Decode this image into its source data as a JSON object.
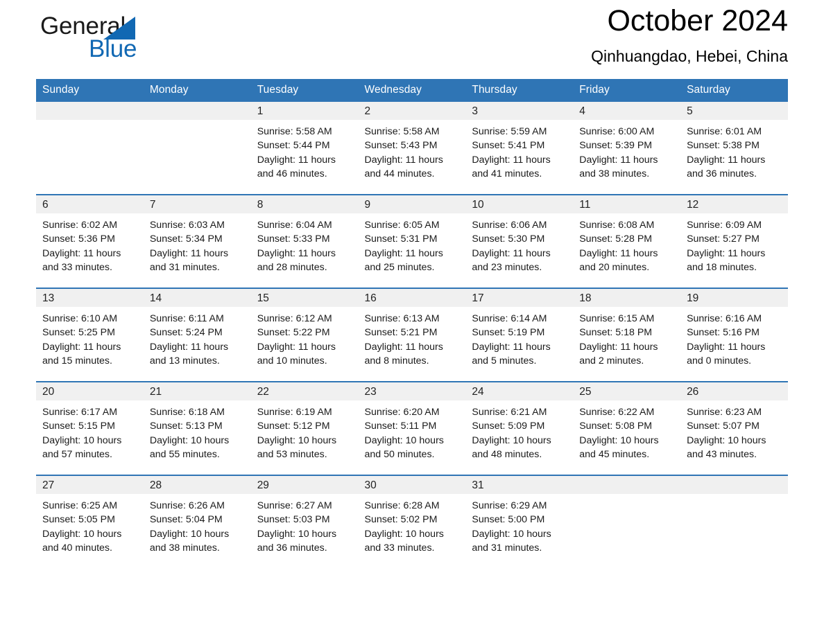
{
  "brand": {
    "name_part1": "General",
    "name_part2": "Blue",
    "triangle_color": "#1168b3"
  },
  "header": {
    "month_title": "October 2024",
    "location": "Qinhuangdao, Hebei, China"
  },
  "theme": {
    "header_blue": "#2f75b5",
    "daynum_band": "#f0f0f0",
    "text": "#1a1a1a"
  },
  "weekday_headers": [
    "Sunday",
    "Monday",
    "Tuesday",
    "Wednesday",
    "Thursday",
    "Friday",
    "Saturday"
  ],
  "weeks": [
    [
      {
        "day": "",
        "sunrise": "",
        "sunset": "",
        "daylight_l1": "",
        "daylight_l2": "",
        "empty": true
      },
      {
        "day": "",
        "sunrise": "",
        "sunset": "",
        "daylight_l1": "",
        "daylight_l2": "",
        "empty": true
      },
      {
        "day": "1",
        "sunrise": "Sunrise: 5:58 AM",
        "sunset": "Sunset: 5:44 PM",
        "daylight_l1": "Daylight: 11 hours",
        "daylight_l2": "and 46 minutes."
      },
      {
        "day": "2",
        "sunrise": "Sunrise: 5:58 AM",
        "sunset": "Sunset: 5:43 PM",
        "daylight_l1": "Daylight: 11 hours",
        "daylight_l2": "and 44 minutes."
      },
      {
        "day": "3",
        "sunrise": "Sunrise: 5:59 AM",
        "sunset": "Sunset: 5:41 PM",
        "daylight_l1": "Daylight: 11 hours",
        "daylight_l2": "and 41 minutes."
      },
      {
        "day": "4",
        "sunrise": "Sunrise: 6:00 AM",
        "sunset": "Sunset: 5:39 PM",
        "daylight_l1": "Daylight: 11 hours",
        "daylight_l2": "and 38 minutes."
      },
      {
        "day": "5",
        "sunrise": "Sunrise: 6:01 AM",
        "sunset": "Sunset: 5:38 PM",
        "daylight_l1": "Daylight: 11 hours",
        "daylight_l2": "and 36 minutes."
      }
    ],
    [
      {
        "day": "6",
        "sunrise": "Sunrise: 6:02 AM",
        "sunset": "Sunset: 5:36 PM",
        "daylight_l1": "Daylight: 11 hours",
        "daylight_l2": "and 33 minutes."
      },
      {
        "day": "7",
        "sunrise": "Sunrise: 6:03 AM",
        "sunset": "Sunset: 5:34 PM",
        "daylight_l1": "Daylight: 11 hours",
        "daylight_l2": "and 31 minutes."
      },
      {
        "day": "8",
        "sunrise": "Sunrise: 6:04 AM",
        "sunset": "Sunset: 5:33 PM",
        "daylight_l1": "Daylight: 11 hours",
        "daylight_l2": "and 28 minutes."
      },
      {
        "day": "9",
        "sunrise": "Sunrise: 6:05 AM",
        "sunset": "Sunset: 5:31 PM",
        "daylight_l1": "Daylight: 11 hours",
        "daylight_l2": "and 25 minutes."
      },
      {
        "day": "10",
        "sunrise": "Sunrise: 6:06 AM",
        "sunset": "Sunset: 5:30 PM",
        "daylight_l1": "Daylight: 11 hours",
        "daylight_l2": "and 23 minutes."
      },
      {
        "day": "11",
        "sunrise": "Sunrise: 6:08 AM",
        "sunset": "Sunset: 5:28 PM",
        "daylight_l1": "Daylight: 11 hours",
        "daylight_l2": "and 20 minutes."
      },
      {
        "day": "12",
        "sunrise": "Sunrise: 6:09 AM",
        "sunset": "Sunset: 5:27 PM",
        "daylight_l1": "Daylight: 11 hours",
        "daylight_l2": "and 18 minutes."
      }
    ],
    [
      {
        "day": "13",
        "sunrise": "Sunrise: 6:10 AM",
        "sunset": "Sunset: 5:25 PM",
        "daylight_l1": "Daylight: 11 hours",
        "daylight_l2": "and 15 minutes."
      },
      {
        "day": "14",
        "sunrise": "Sunrise: 6:11 AM",
        "sunset": "Sunset: 5:24 PM",
        "daylight_l1": "Daylight: 11 hours",
        "daylight_l2": "and 13 minutes."
      },
      {
        "day": "15",
        "sunrise": "Sunrise: 6:12 AM",
        "sunset": "Sunset: 5:22 PM",
        "daylight_l1": "Daylight: 11 hours",
        "daylight_l2": "and 10 minutes."
      },
      {
        "day": "16",
        "sunrise": "Sunrise: 6:13 AM",
        "sunset": "Sunset: 5:21 PM",
        "daylight_l1": "Daylight: 11 hours",
        "daylight_l2": "and 8 minutes."
      },
      {
        "day": "17",
        "sunrise": "Sunrise: 6:14 AM",
        "sunset": "Sunset: 5:19 PM",
        "daylight_l1": "Daylight: 11 hours",
        "daylight_l2": "and 5 minutes."
      },
      {
        "day": "18",
        "sunrise": "Sunrise: 6:15 AM",
        "sunset": "Sunset: 5:18 PM",
        "daylight_l1": "Daylight: 11 hours",
        "daylight_l2": "and 2 minutes."
      },
      {
        "day": "19",
        "sunrise": "Sunrise: 6:16 AM",
        "sunset": "Sunset: 5:16 PM",
        "daylight_l1": "Daylight: 11 hours",
        "daylight_l2": "and 0 minutes."
      }
    ],
    [
      {
        "day": "20",
        "sunrise": "Sunrise: 6:17 AM",
        "sunset": "Sunset: 5:15 PM",
        "daylight_l1": "Daylight: 10 hours",
        "daylight_l2": "and 57 minutes."
      },
      {
        "day": "21",
        "sunrise": "Sunrise: 6:18 AM",
        "sunset": "Sunset: 5:13 PM",
        "daylight_l1": "Daylight: 10 hours",
        "daylight_l2": "and 55 minutes."
      },
      {
        "day": "22",
        "sunrise": "Sunrise: 6:19 AM",
        "sunset": "Sunset: 5:12 PM",
        "daylight_l1": "Daylight: 10 hours",
        "daylight_l2": "and 53 minutes."
      },
      {
        "day": "23",
        "sunrise": "Sunrise: 6:20 AM",
        "sunset": "Sunset: 5:11 PM",
        "daylight_l1": "Daylight: 10 hours",
        "daylight_l2": "and 50 minutes."
      },
      {
        "day": "24",
        "sunrise": "Sunrise: 6:21 AM",
        "sunset": "Sunset: 5:09 PM",
        "daylight_l1": "Daylight: 10 hours",
        "daylight_l2": "and 48 minutes."
      },
      {
        "day": "25",
        "sunrise": "Sunrise: 6:22 AM",
        "sunset": "Sunset: 5:08 PM",
        "daylight_l1": "Daylight: 10 hours",
        "daylight_l2": "and 45 minutes."
      },
      {
        "day": "26",
        "sunrise": "Sunrise: 6:23 AM",
        "sunset": "Sunset: 5:07 PM",
        "daylight_l1": "Daylight: 10 hours",
        "daylight_l2": "and 43 minutes."
      }
    ],
    [
      {
        "day": "27",
        "sunrise": "Sunrise: 6:25 AM",
        "sunset": "Sunset: 5:05 PM",
        "daylight_l1": "Daylight: 10 hours",
        "daylight_l2": "and 40 minutes."
      },
      {
        "day": "28",
        "sunrise": "Sunrise: 6:26 AM",
        "sunset": "Sunset: 5:04 PM",
        "daylight_l1": "Daylight: 10 hours",
        "daylight_l2": "and 38 minutes."
      },
      {
        "day": "29",
        "sunrise": "Sunrise: 6:27 AM",
        "sunset": "Sunset: 5:03 PM",
        "daylight_l1": "Daylight: 10 hours",
        "daylight_l2": "and 36 minutes."
      },
      {
        "day": "30",
        "sunrise": "Sunrise: 6:28 AM",
        "sunset": "Sunset: 5:02 PM",
        "daylight_l1": "Daylight: 10 hours",
        "daylight_l2": "and 33 minutes."
      },
      {
        "day": "31",
        "sunrise": "Sunrise: 6:29 AM",
        "sunset": "Sunset: 5:00 PM",
        "daylight_l1": "Daylight: 10 hours",
        "daylight_l2": "and 31 minutes."
      },
      {
        "day": "",
        "sunrise": "",
        "sunset": "",
        "daylight_l1": "",
        "daylight_l2": "",
        "empty": true
      },
      {
        "day": "",
        "sunrise": "",
        "sunset": "",
        "daylight_l1": "",
        "daylight_l2": "",
        "empty": true
      }
    ]
  ]
}
